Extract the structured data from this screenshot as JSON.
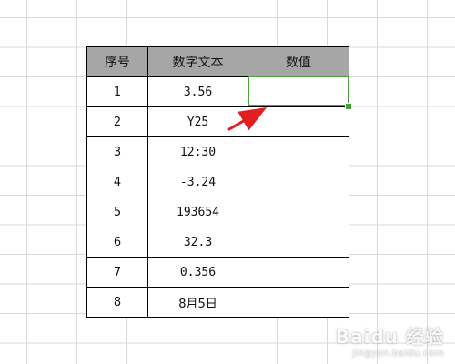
{
  "table": {
    "headers": [
      "序号",
      "数字文本",
      "数值"
    ],
    "rows": [
      {
        "index": "1",
        "text": "3.56",
        "value": ""
      },
      {
        "index": "2",
        "text": "Y25",
        "value": ""
      },
      {
        "index": "3",
        "text": "12:30",
        "value": ""
      },
      {
        "index": "4",
        "text": "-3.24",
        "value": ""
      },
      {
        "index": "5",
        "text": "193654",
        "value": ""
      },
      {
        "index": "6",
        "text": "32.3",
        "value": ""
      },
      {
        "index": "7",
        "text": "0.356",
        "value": ""
      },
      {
        "index": "8",
        "text": "8月5日",
        "value": ""
      }
    ]
  },
  "selection": {
    "cell": "C2",
    "color": "#4a9e3c"
  },
  "arrow": {
    "color": "#e02020"
  },
  "watermark": {
    "top": "Baidu 经验",
    "bottom": "jingyan.baidu.com"
  }
}
